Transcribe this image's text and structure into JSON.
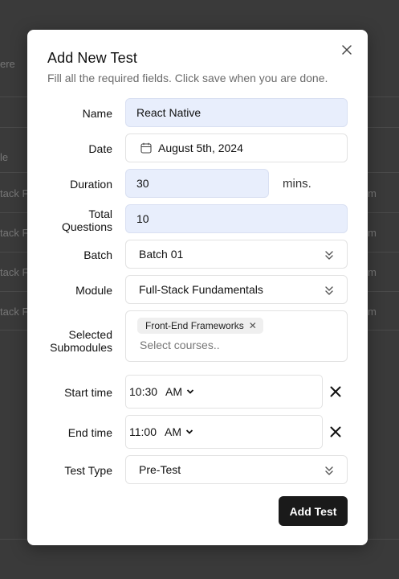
{
  "background": {
    "fragments": [
      "ere",
      "le",
      "tack F",
      "tack F",
      "tack F",
      "tack F",
      "m",
      "m",
      "m",
      "m"
    ]
  },
  "modal": {
    "title": "Add New Test",
    "subtitle": "Fill all the required fields. Click save when you are done.",
    "fields": {
      "name": {
        "label": "Name",
        "value": "React Native"
      },
      "date": {
        "label": "Date",
        "value": "August 5th, 2024",
        "icon": "calendar-icon"
      },
      "duration": {
        "label": "Duration",
        "value": "30",
        "suffix": "mins."
      },
      "total_questions": {
        "label_line1": "Total",
        "label_line2": "Questions",
        "value": "10"
      },
      "batch": {
        "label": "Batch",
        "value": "Batch 01"
      },
      "module": {
        "label": "Module",
        "value": "Full-Stack Fundamentals"
      },
      "submodules": {
        "label_line1": "Selected",
        "label_line2": "Submodules",
        "chips": [
          "Front-End Frameworks"
        ],
        "placeholder": "Select courses.."
      },
      "start_time": {
        "label": "Start time",
        "time": "10:30",
        "period": "AM"
      },
      "end_time": {
        "label": "End time",
        "time": "11:00",
        "period": "AM"
      },
      "test_type": {
        "label": "Test Type",
        "value": "Pre-Test"
      }
    },
    "submit_label": "Add Test"
  }
}
